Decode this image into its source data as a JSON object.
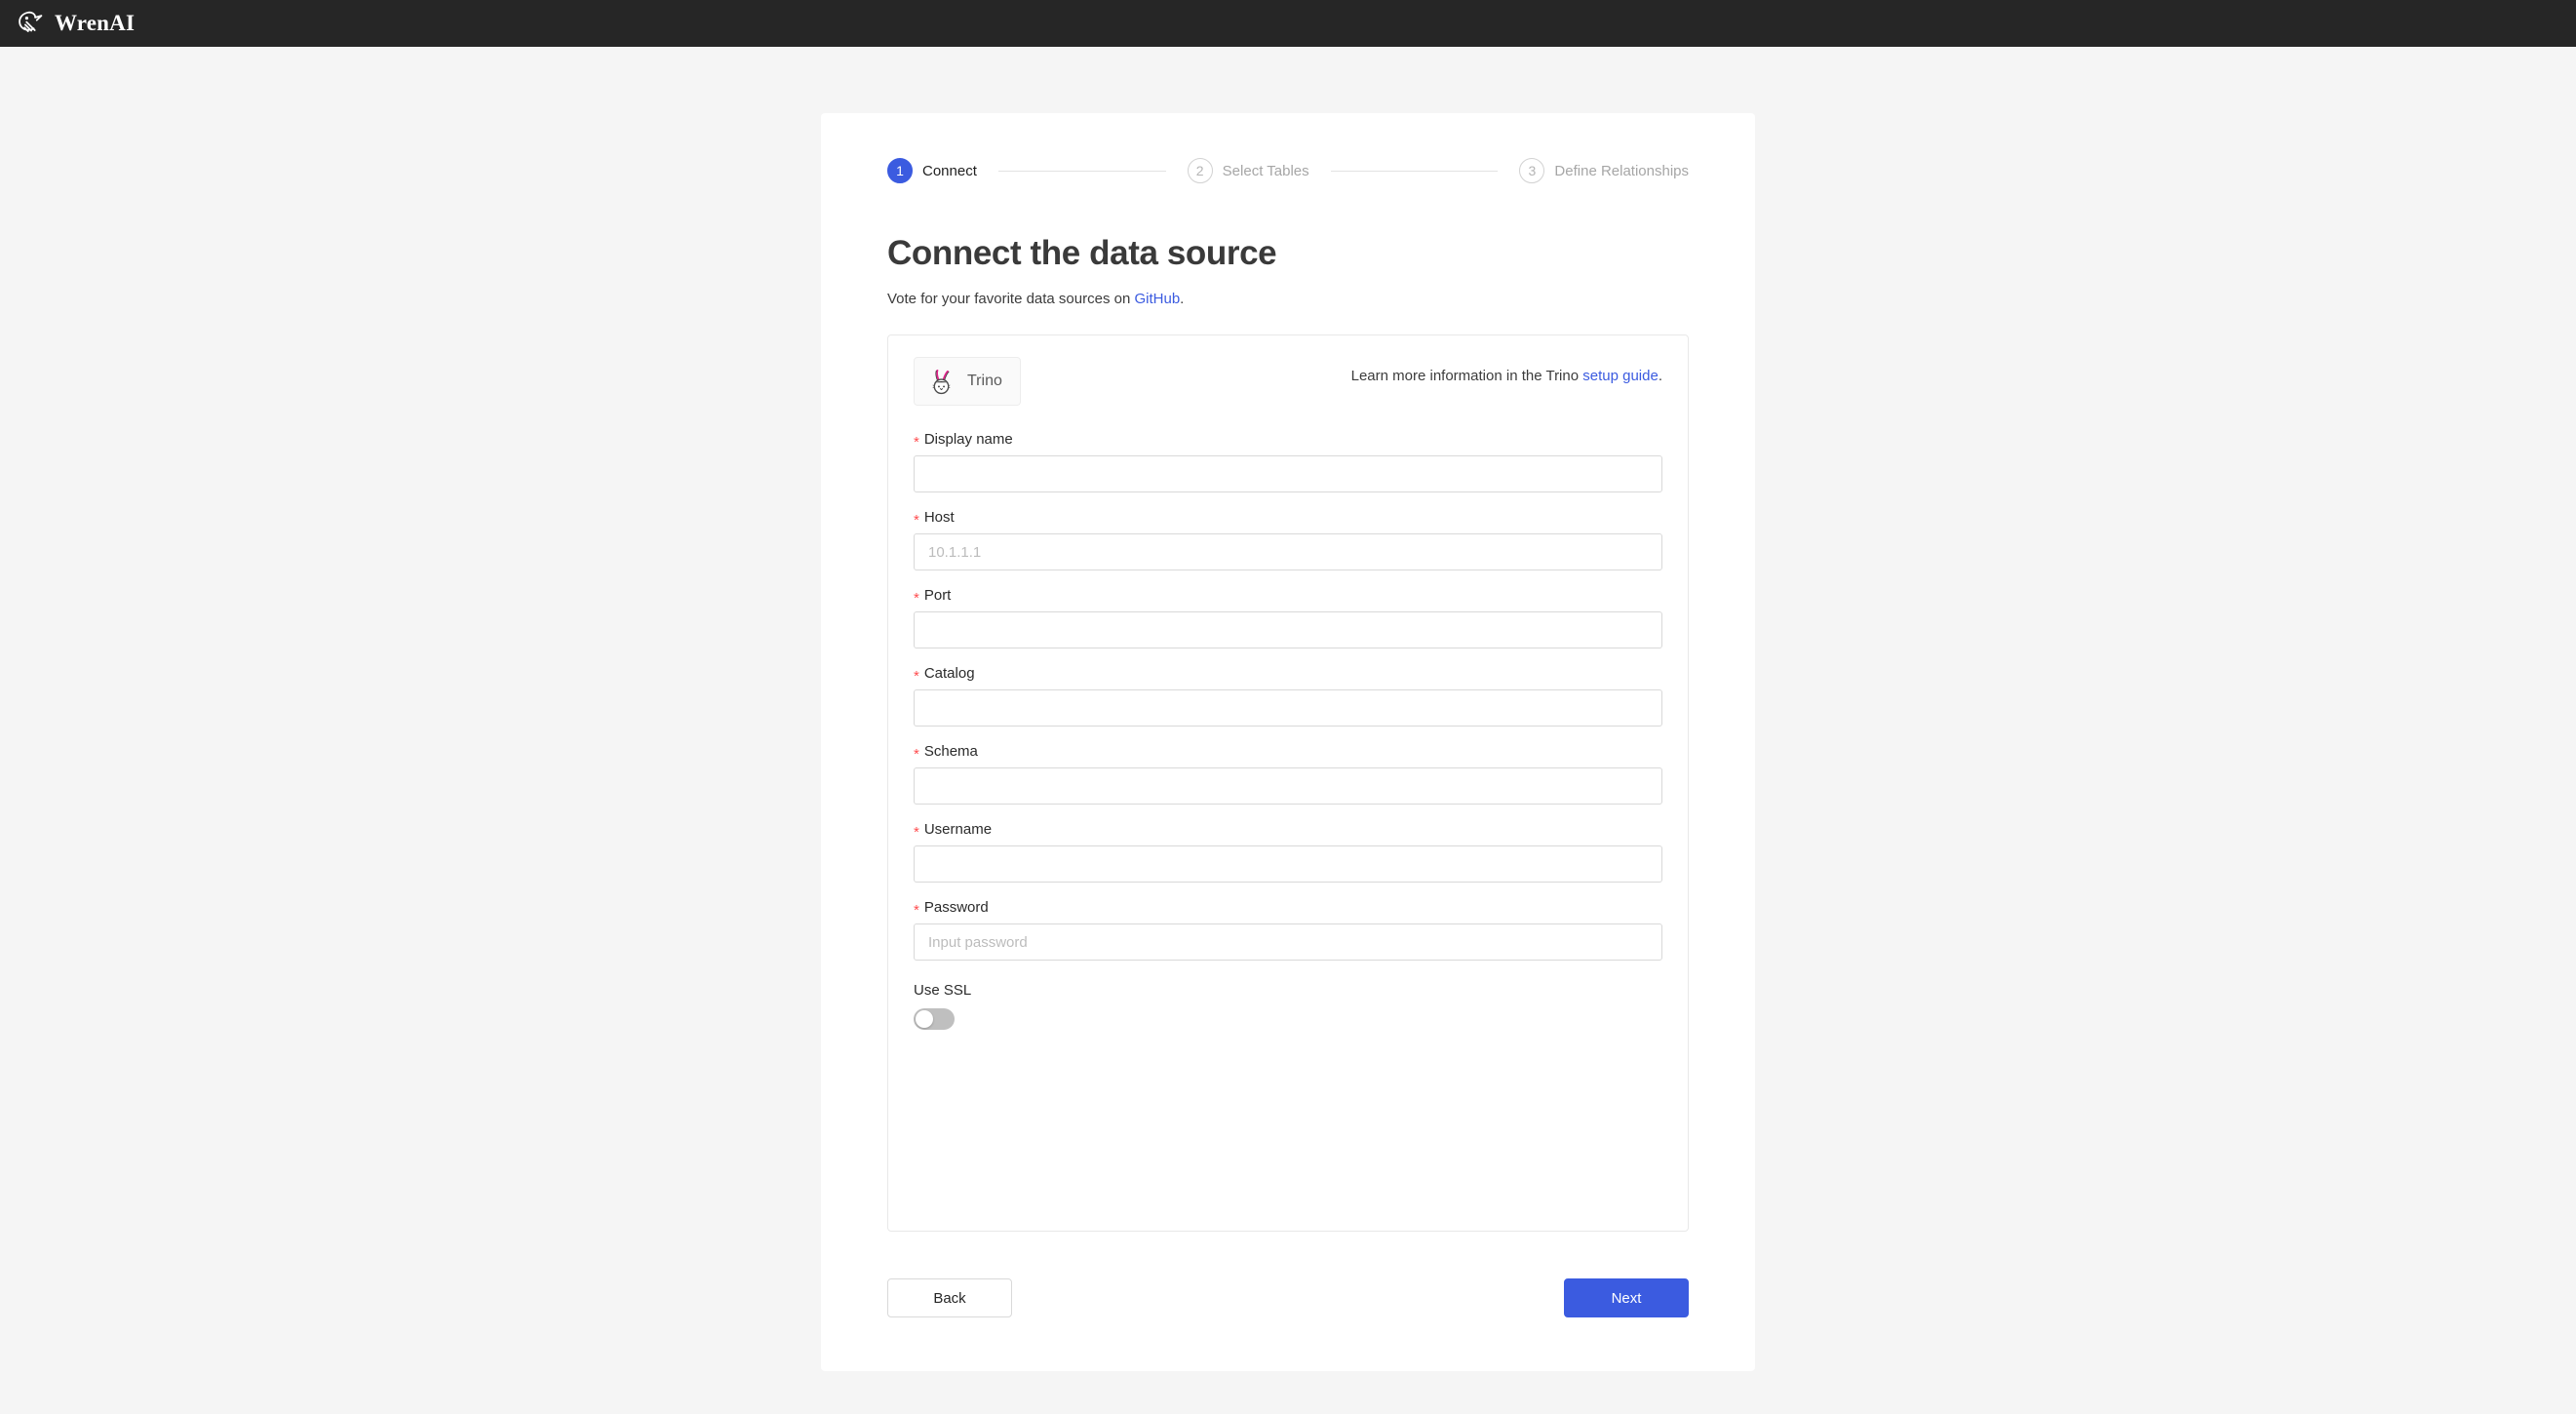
{
  "topbar": {
    "brand": "WrenAI",
    "logo_icon": "wren-bird-icon"
  },
  "stepper": {
    "steps": [
      {
        "number": "1",
        "label": "Connect",
        "state": "active"
      },
      {
        "number": "2",
        "label": "Select Tables",
        "state": "inactive"
      },
      {
        "number": "3",
        "label": "Define Relationships",
        "state": "inactive"
      }
    ]
  },
  "header": {
    "title": "Connect the data source",
    "subtitle_prefix": "Vote for your favorite data sources on ",
    "subtitle_link": "GitHub",
    "subtitle_suffix": "."
  },
  "panel": {
    "datasource": {
      "name": "Trino",
      "logo_icon": "trino-rabbit-icon"
    },
    "note_prefix": "Learn more information in the Trino ",
    "note_link": "setup guide",
    "note_suffix": "."
  },
  "form": {
    "fields": [
      {
        "label": "Display name",
        "required": true,
        "value": "",
        "placeholder": "",
        "type": "text"
      },
      {
        "label": "Host",
        "required": true,
        "value": "",
        "placeholder": "10.1.1.1",
        "type": "text"
      },
      {
        "label": "Port",
        "required": true,
        "value": "",
        "placeholder": "",
        "type": "text"
      },
      {
        "label": "Catalog",
        "required": true,
        "value": "",
        "placeholder": "",
        "type": "text"
      },
      {
        "label": "Schema",
        "required": true,
        "value": "",
        "placeholder": "",
        "type": "text"
      },
      {
        "label": "Username",
        "required": true,
        "value": "",
        "placeholder": "",
        "type": "text"
      },
      {
        "label": "Password",
        "required": true,
        "value": "",
        "placeholder": "Input password",
        "type": "password"
      }
    ],
    "ssl": {
      "label": "Use SSL",
      "enabled": false
    }
  },
  "footer": {
    "back_label": "Back",
    "next_label": "Next"
  },
  "colors": {
    "accent": "#3b5be0",
    "topbar": "#262626",
    "page_bg": "#f5f5f5",
    "required_star": "#ff4d4f",
    "toggle_off": "#bfbfbf",
    "trino_ear": "#e0218a"
  }
}
